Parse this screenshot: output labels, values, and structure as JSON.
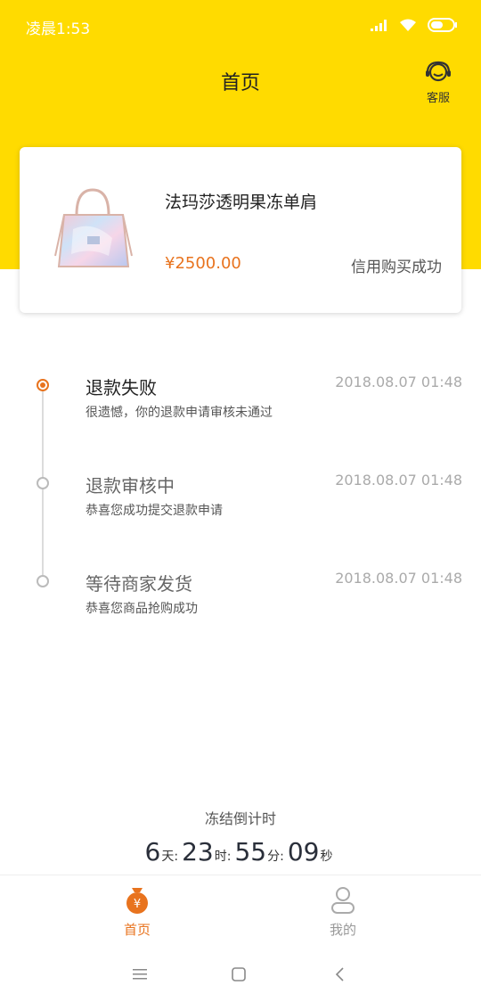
{
  "status_bar": {
    "time": "凌晨1:53"
  },
  "header": {
    "title": "首页",
    "service_label": "客服"
  },
  "product": {
    "title": "法玛莎透明果冻单肩",
    "price": "¥2500.00",
    "status": "信用购买成功"
  },
  "timeline": [
    {
      "title": "退款失败",
      "desc": "很遗憾，你的退款申请审核未通过",
      "time": "2018.08.07 01:48"
    },
    {
      "title": "退款审核中",
      "desc": "恭喜您成功提交退款申请",
      "time": "2018.08.07 01:48"
    },
    {
      "title": "等待商家发货",
      "desc": "恭喜您商品抢购成功",
      "time": "2018.08.07 01:48"
    }
  ],
  "countdown": {
    "label": "冻结倒计时",
    "days": "6",
    "days_unit": "天:",
    "hours": "23",
    "hours_unit": "时:",
    "minutes": "55",
    "minutes_unit": "分:",
    "seconds": "09",
    "seconds_unit": "秒"
  },
  "tabbar": {
    "home_label": "首页",
    "mine_label": "我的"
  },
  "colors": {
    "brand_yellow": "#FFDB00",
    "accent_orange": "#E8731E"
  },
  "icons": [
    "wifi-icon",
    "battery-icon",
    "signal-icon",
    "headset-icon",
    "money-bag-icon",
    "user-icon",
    "menu-icon",
    "home-square-icon",
    "back-icon"
  ]
}
